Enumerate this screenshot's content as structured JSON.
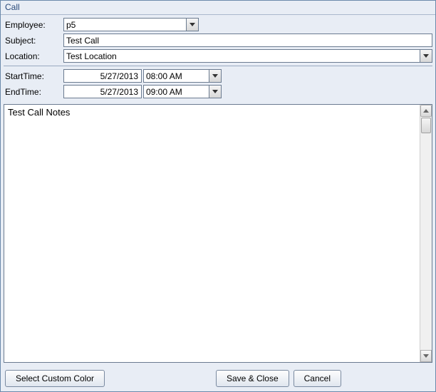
{
  "window": {
    "title": "Call"
  },
  "form": {
    "employee": {
      "label": "Employee:",
      "value": "p5"
    },
    "subject": {
      "label": "Subject:",
      "value": "Test Call"
    },
    "location": {
      "label": "Location:",
      "value": "Test Location"
    },
    "start": {
      "label": "StartTime:",
      "date": "5/27/2013",
      "time": "08:00 AM"
    },
    "end": {
      "label": "EndTime:",
      "date": "5/27/2013",
      "time": "09:00 AM"
    }
  },
  "notes": {
    "value": "Test Call Notes"
  },
  "buttons": {
    "select_color": "Select Custom Color",
    "save_close": "Save & Close",
    "cancel": "Cancel"
  }
}
